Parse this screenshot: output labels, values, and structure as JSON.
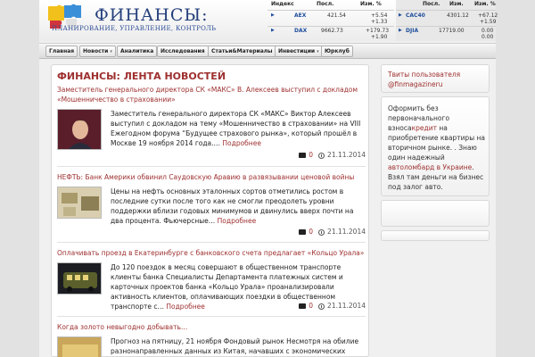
{
  "header": {
    "logo_title": "ФИНАНСЫ:",
    "logo_subtitle": "ПЛАНИРОВАНИЕ, УПРАВЛЕНИЕ, КОНТРОЛЬ"
  },
  "ticker": {
    "headers": {
      "index": "Индекс",
      "last": "Посл.",
      "change": "Изм.",
      "change_pct": "Изм. %"
    },
    "left": [
      {
        "name": "AEX",
        "last": "421.54",
        "change": "+5.54",
        "change_pct": "+1.33"
      },
      {
        "name": "DAX",
        "last": "9662.73",
        "change": "+179.73",
        "change_pct": "+1.90"
      }
    ],
    "right": [
      {
        "name": "CAC40",
        "last": "4301.12",
        "change": "+67.12",
        "change_pct": "+1.59"
      },
      {
        "name": "DJIA",
        "last": "17719.00",
        "change": "0.00",
        "change_pct": "0.00"
      }
    ]
  },
  "nav": {
    "items": [
      {
        "label": "Главная",
        "dropdown": false
      },
      {
        "label": "Новости",
        "dropdown": true
      },
      {
        "label": "Аналитика",
        "dropdown": false
      },
      {
        "label": "Исследования",
        "dropdown": false
      },
      {
        "label": "Статьи&Материалы",
        "dropdown": true
      },
      {
        "label": "Инвестиции",
        "dropdown": true
      },
      {
        "label": "Юрклуб",
        "dropdown": false
      }
    ],
    "caret": "▾"
  },
  "main": {
    "title": "ФИНАНСЫ: ЛЕНТА НОВОСТЕЙ",
    "more_label": "Подробнее",
    "articles": [
      {
        "title": "Заместитель генерального директора СК «МАКС» В. Алексеев выступил с докладом «Мошенничество в страховании»",
        "text": "Заместитель генерального директора СК «МАКС» Виктор Алексеев выступил с докладом на тему «Мошенничество в страховании» на VIII Ежегодном форума “Будущее страхового рынка», который прошёл в Москве 19 ноября 2014 года.…",
        "comments": "0",
        "date": "21.11.2014"
      },
      {
        "title": "НЕФТЬ: Банк Америки обвинил Саудовскую Аравию в развязывании ценовой войны",
        "text": "Цены на нефть основных эталонных сортов отметились ростом в последние сутки после того как не смогли преодолеть уровни поддержки вблизи годовых минимумов и двинулись вверх почти на два процента. Фьючерсные…",
        "comments": "0",
        "date": "21.11.2014"
      },
      {
        "title": "Оплачивать проезд в Екатеринбурге с банковского счета предлагает «Кольцо Урала»",
        "text": "До 120 поездок в месяц совершают в общественном транспорте клиенты банка Специалисты Департамента платежных систем и карточных проектов банка «Кольцо Урала» проанализировали активность клиентов, оплачивающих поездки в общественном транспорте с…",
        "comments": "0",
        "date": "21.11.2014"
      },
      {
        "title": "Когда золото невыгодно добывать…",
        "text": "Прогноз на пятницу, 21 ноября Фондовый рынок Несмотря на обилие разнонаправленных данных из Китая, начавших с экономических отчетов, и",
        "comments": "",
        "date": ""
      }
    ]
  },
  "sidebar": {
    "twitter_text": "Твиты пользователя @finmagazineru",
    "ad": {
      "part1": "Оформить без первоначального взноса",
      "link1": "кредит",
      "part2": "на приобретение квартиры на вторичном рынке. . Знаю один надежный",
      "link2": "автоломбард в Украине",
      "part3": ". Взял там деньги на бизнес под залог авто."
    }
  }
}
